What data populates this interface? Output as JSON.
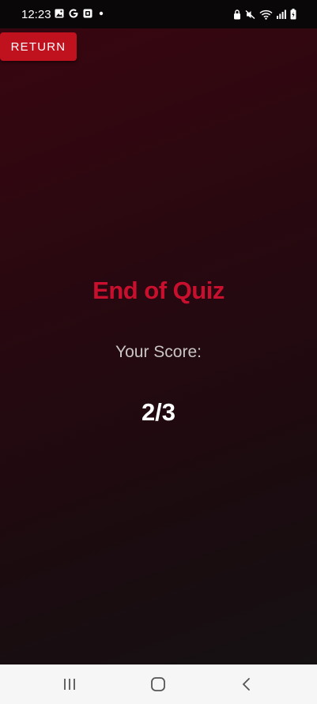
{
  "status_bar": {
    "time": "12:23",
    "left_icons": [
      "image-icon",
      "google-icon",
      "app-icon",
      "dot-icon"
    ],
    "right_icons": [
      "lock-icon",
      "mute-icon",
      "wifi-icon",
      "signal-icon",
      "battery-icon"
    ]
  },
  "header": {
    "return_label": "RETURN"
  },
  "main": {
    "title": "End of Quiz",
    "score_label": "Your Score:",
    "score_value": "2/3"
  },
  "nav_bar": {
    "buttons": [
      "recent-apps-icon",
      "home-icon",
      "back-icon"
    ]
  },
  "colors": {
    "accent": "#c0111f",
    "title": "#c8102e",
    "background_start": "#3a0610",
    "background_end": "#141214"
  }
}
